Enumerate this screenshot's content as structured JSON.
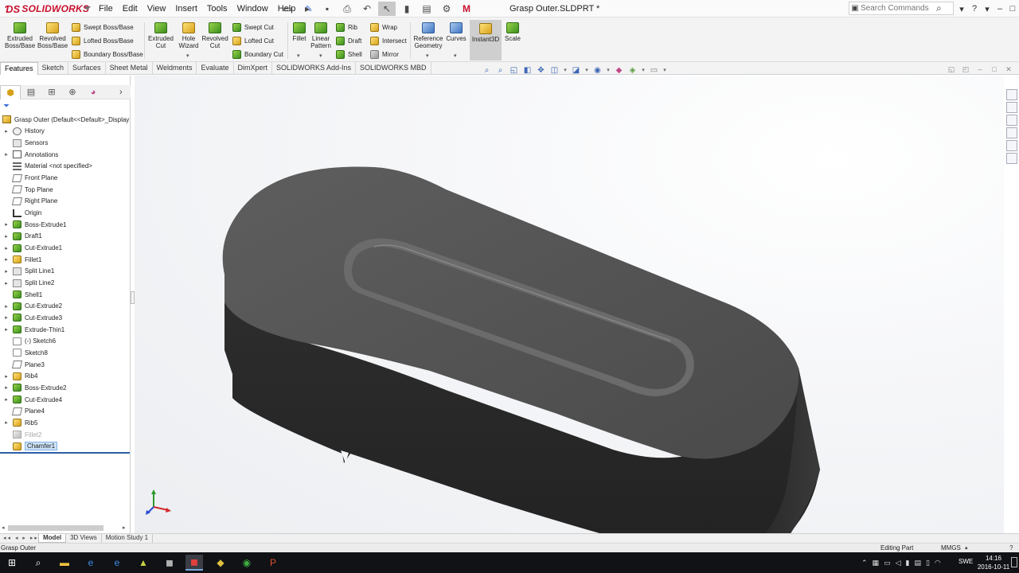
{
  "app": {
    "logo": "SOLIDWORKS",
    "menus": [
      "File",
      "Edit",
      "View",
      "Insert",
      "Tools",
      "Window",
      "Help"
    ],
    "document_title": "Grasp Outer.SLDPRT *",
    "search_placeholder": "Search Commands"
  },
  "commands": {
    "extruded_boss": "Extruded Boss/Base",
    "revolved_boss": "Revolved Boss/Base",
    "swept_boss": "Swept Boss/Base",
    "lofted_boss": "Lofted Boss/Base",
    "boundary_boss": "Boundary Boss/Base",
    "extruded_cut": "Extruded Cut",
    "hole_wizard": "Hole Wizard",
    "revolved_cut": "Revolved Cut",
    "swept_cut": "Swept Cut",
    "lofted_cut": "Lofted Cut",
    "boundary_cut": "Boundary Cut",
    "fillet": "Fillet",
    "linear_pattern": "Linear Pattern",
    "rib": "Rib",
    "draft": "Draft",
    "shell": "Shell",
    "wrap": "Wrap",
    "intersect": "Intersect",
    "mirror": "Mirror",
    "reference_geometry": "Reference Geometry",
    "curves": "Curves",
    "instant3d": "Instant3D",
    "scale": "Scale"
  },
  "tabs": [
    "Features",
    "Sketch",
    "Surfaces",
    "Sheet Metal",
    "Weldments",
    "Evaluate",
    "DimXpert",
    "SOLIDWORKS Add-Ins",
    "SOLIDWORKS MBD"
  ],
  "active_tab": "Features",
  "tree": {
    "root": "Grasp Outer  (Default<<Default>_Display",
    "items": [
      {
        "label": "History",
        "icon": "history-icon",
        "expand": true
      },
      {
        "label": "Sensors",
        "icon": "sensors-icon",
        "expand": false
      },
      {
        "label": "Annotations",
        "icon": "annotations-icon",
        "expand": true
      },
      {
        "label": "Material <not specified>",
        "icon": "material-icon",
        "expand": false
      },
      {
        "label": "Front Plane",
        "icon": "plane-icon",
        "expand": false
      },
      {
        "label": "Top Plane",
        "icon": "plane-icon",
        "expand": false
      },
      {
        "label": "Right Plane",
        "icon": "plane-icon",
        "expand": false
      },
      {
        "label": "Origin",
        "icon": "origin-icon",
        "expand": false
      },
      {
        "label": "Boss-Extrude1",
        "icon": "boss-extrude-icon",
        "expand": true
      },
      {
        "label": "Draft1",
        "icon": "draft-icon",
        "expand": true
      },
      {
        "label": "Cut-Extrude1",
        "icon": "cut-extrude-icon",
        "expand": true
      },
      {
        "label": "Fillet1",
        "icon": "fillet-icon",
        "expand": true
      },
      {
        "label": "Split Line1",
        "icon": "split-line-icon",
        "expand": true
      },
      {
        "label": "Split Line2",
        "icon": "split-line-icon",
        "expand": true
      },
      {
        "label": "Shell1",
        "icon": "shell-icon",
        "expand": false
      },
      {
        "label": "Cut-Extrude2",
        "icon": "cut-extrude-icon",
        "expand": true
      },
      {
        "label": "Cut-Extrude3",
        "icon": "cut-extrude-icon",
        "expand": true
      },
      {
        "label": "Extrude-Thin1",
        "icon": "extrude-thin-icon",
        "expand": true
      },
      {
        "label": "(-) Sketch6",
        "icon": "sketch-icon",
        "expand": false
      },
      {
        "label": "Sketch8",
        "icon": "sketch-icon",
        "expand": false
      },
      {
        "label": "Plane3",
        "icon": "plane-icon",
        "expand": false
      },
      {
        "label": "Rib4",
        "icon": "rib-icon",
        "expand": true
      },
      {
        "label": "Boss-Extrude2",
        "icon": "boss-extrude-icon",
        "expand": true
      },
      {
        "label": "Cut-Extrude4",
        "icon": "cut-extrude-icon",
        "expand": true
      },
      {
        "label": "Plane4",
        "icon": "plane-icon",
        "expand": false
      },
      {
        "label": "Rib5",
        "icon": "rib-icon",
        "expand": true
      },
      {
        "label": "Fillet2",
        "icon": "fillet-icon",
        "expand": false,
        "suppressed": true
      },
      {
        "label": "Chamfer1",
        "icon": "chamfer-icon",
        "expand": false,
        "selected": true
      }
    ]
  },
  "bottom_tabs": [
    "Model",
    "3D Views",
    "Motion Study 1"
  ],
  "active_bottom_tab": "Model",
  "status": {
    "left": "Grasp Outer",
    "editing": "Editing Part",
    "units": "MMGS"
  },
  "taskbar": {
    "clock_time": "14:16",
    "clock_date": "2016-10-11",
    "language": "SWE"
  },
  "colors": {
    "brand_red": "#c8102e",
    "selection_blue": "#cde3f7",
    "part_gray": "#4d4d4d"
  }
}
